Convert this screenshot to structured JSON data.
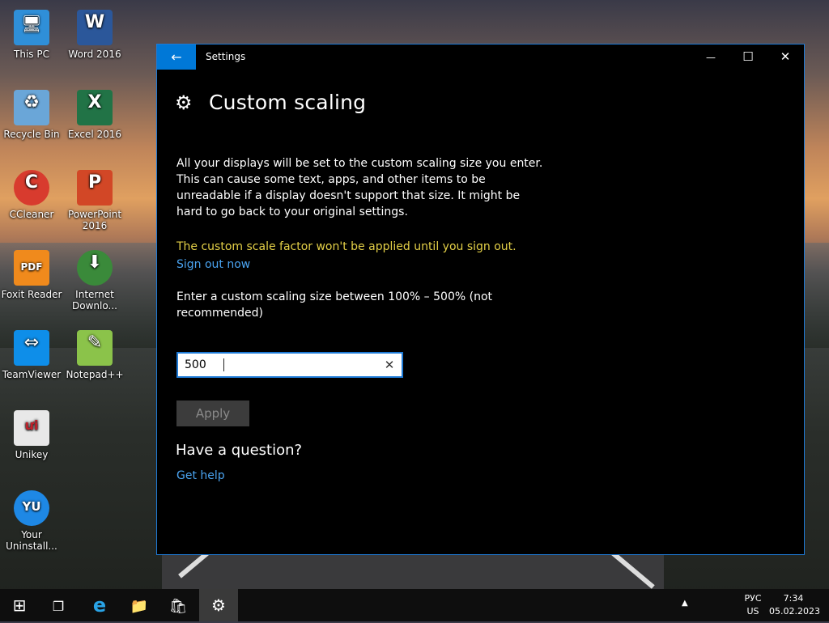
{
  "desktop": {
    "icons": [
      {
        "label": "This PC",
        "color": "#2f8fd8",
        "glyph": "🖥"
      },
      {
        "label": "Word 2016",
        "color": "#2b579a",
        "glyph": "W"
      },
      {
        "label": "Recycle Bin",
        "color": "#6aa6d8",
        "glyph": "♻"
      },
      {
        "label": "Excel 2016",
        "color": "#217346",
        "glyph": "X"
      },
      {
        "label": "CCleaner",
        "color": "#d83b2e",
        "glyph": "C"
      },
      {
        "label": "PowerPoint 2016",
        "color": "#d24726",
        "glyph": "P"
      },
      {
        "label": "Foxit Reader",
        "color": "#f08a1c",
        "glyph": "PDF"
      },
      {
        "label": "Internet Downlo...",
        "color": "#3a8a3a",
        "glyph": "⬇"
      },
      {
        "label": "TeamViewer",
        "color": "#0e8ee9",
        "glyph": "⇔"
      },
      {
        "label": "Notepad++",
        "color": "#8bc34a",
        "glyph": "✎"
      },
      {
        "label": "Unikey",
        "color": "#e8e8e8",
        "glyph": "ưi"
      },
      {
        "label": "Your Uninstall...",
        "color": "#1e88e5",
        "glyph": "YU"
      }
    ]
  },
  "window": {
    "title": "Settings",
    "back_glyph": "←",
    "minimize_glyph": "—",
    "maximize_glyph": "☐",
    "close_glyph": "✕",
    "accent": "#0078d7"
  },
  "page": {
    "gear_glyph": "⚙",
    "title": "Custom scaling",
    "description": "All your displays will be set to the custom scaling size you enter. This can cause some text, apps, and other items to be unreadable if a display doesn't support that size. It might be hard to go back to your original settings.",
    "warning": "The custom scale factor won't be applied until you sign out.",
    "warning_color": "#e3cf47",
    "sign_out_link": "Sign out now",
    "prompt": "Enter a custom scaling size between 100% – 500% (not recommended)",
    "input_value": "500",
    "clear_glyph": "✕",
    "apply_label": "Apply",
    "question_title": "Have a question?",
    "help_link": "Get help",
    "link_color": "#4aa3f0"
  },
  "taskbar": {
    "start_glyph": "⊞",
    "taskview_glyph": "❐",
    "ie_glyph": "e",
    "explorer_glyph": "📁",
    "store_glyph": "🛍",
    "settings_glyph": "⚙",
    "tray_arrow": "▲",
    "lang_top": "РУС",
    "lang_bottom": "US",
    "time": "7:34",
    "date": "05.02.2023"
  }
}
